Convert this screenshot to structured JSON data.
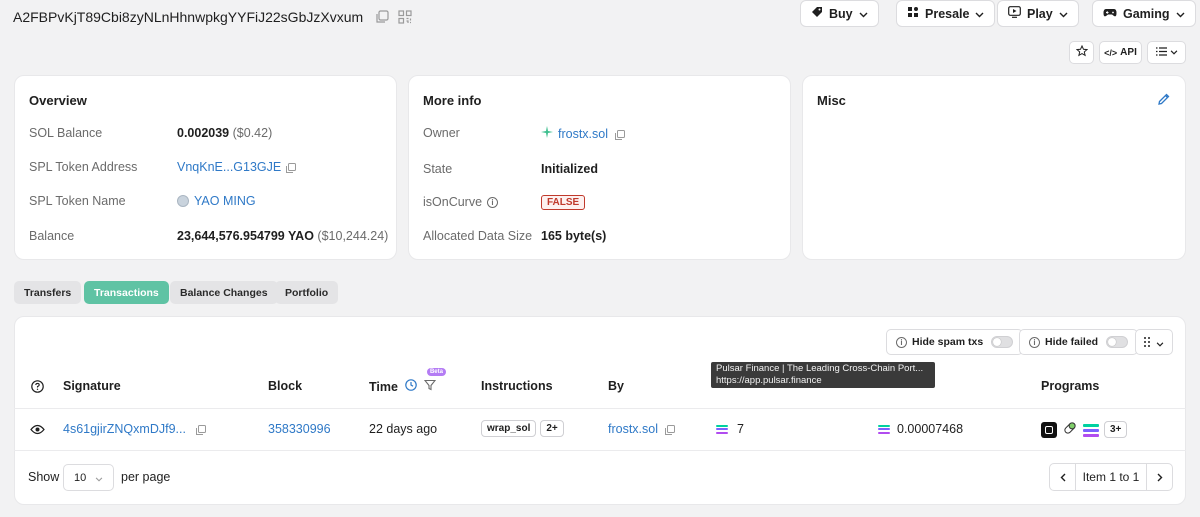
{
  "header": {
    "address": "A2FBPvKjT89Cbi8zyNLnHhnwpkgYYFiJ22sGbJzXvxum",
    "nav": [
      {
        "label": "Buy",
        "icon": "tag-icon"
      },
      {
        "label": "Presale",
        "icon": "presale-icon"
      },
      {
        "label": "Play",
        "icon": "play-icon"
      },
      {
        "label": "Gaming",
        "icon": "gamepad-icon"
      }
    ],
    "api_label": "API"
  },
  "overview": {
    "title": "Overview",
    "sol_balance_label": "SOL Balance",
    "sol_balance_value": "0.002039",
    "sol_balance_usd": "($0.42)",
    "token_address_label": "SPL Token Address",
    "token_address_value": "VnqKnE...G13GJE",
    "token_name_label": "SPL Token Name",
    "token_name_value": "YAO MING",
    "balance_label": "Balance",
    "balance_value": "23,644,576.954799 YAO",
    "balance_usd": "($10,244.24)"
  },
  "more_info": {
    "title": "More info",
    "owner_label": "Owner",
    "owner_value": "frostx.sol",
    "state_label": "State",
    "state_value": "Initialized",
    "curve_label": "isOnCurve",
    "curve_value": "FALSE",
    "data_size_label": "Allocated Data Size",
    "data_size_value": "165 byte(s)"
  },
  "misc": {
    "title": "Misc"
  },
  "tabs": [
    "Transfers",
    "Transactions",
    "Balance Changes",
    "Portfolio"
  ],
  "filters": {
    "hide_spam": "Hide spam txs",
    "hide_failed": "Hide failed"
  },
  "tooltip": {
    "line1": "Pulsar Finance | The Leading Cross-Chain Port...",
    "line2": "https://app.pulsar.finance"
  },
  "table": {
    "headers": {
      "signature": "Signature",
      "block": "Block",
      "time": "Time",
      "beta": "Beta",
      "instructions": "Instructions",
      "by": "By",
      "programs": "Programs"
    },
    "rows": [
      {
        "signature": "4s61gjirZNQxmDJf9...",
        "block": "358330996",
        "time": "22 days ago",
        "instruction": "wrap_sol",
        "instruction_more": "2+",
        "by": "frostx.sol",
        "value": "7",
        "fee": "0.00007468",
        "programs_more": "3+"
      }
    ]
  },
  "pagination": {
    "show_label": "Show",
    "page_size": "10",
    "per_page_label": "per page",
    "range": "Item 1 to 1"
  },
  "colors": {
    "accent": "#5fc3a4",
    "link": "#2f79c7",
    "false_badge": "#c0392b"
  }
}
